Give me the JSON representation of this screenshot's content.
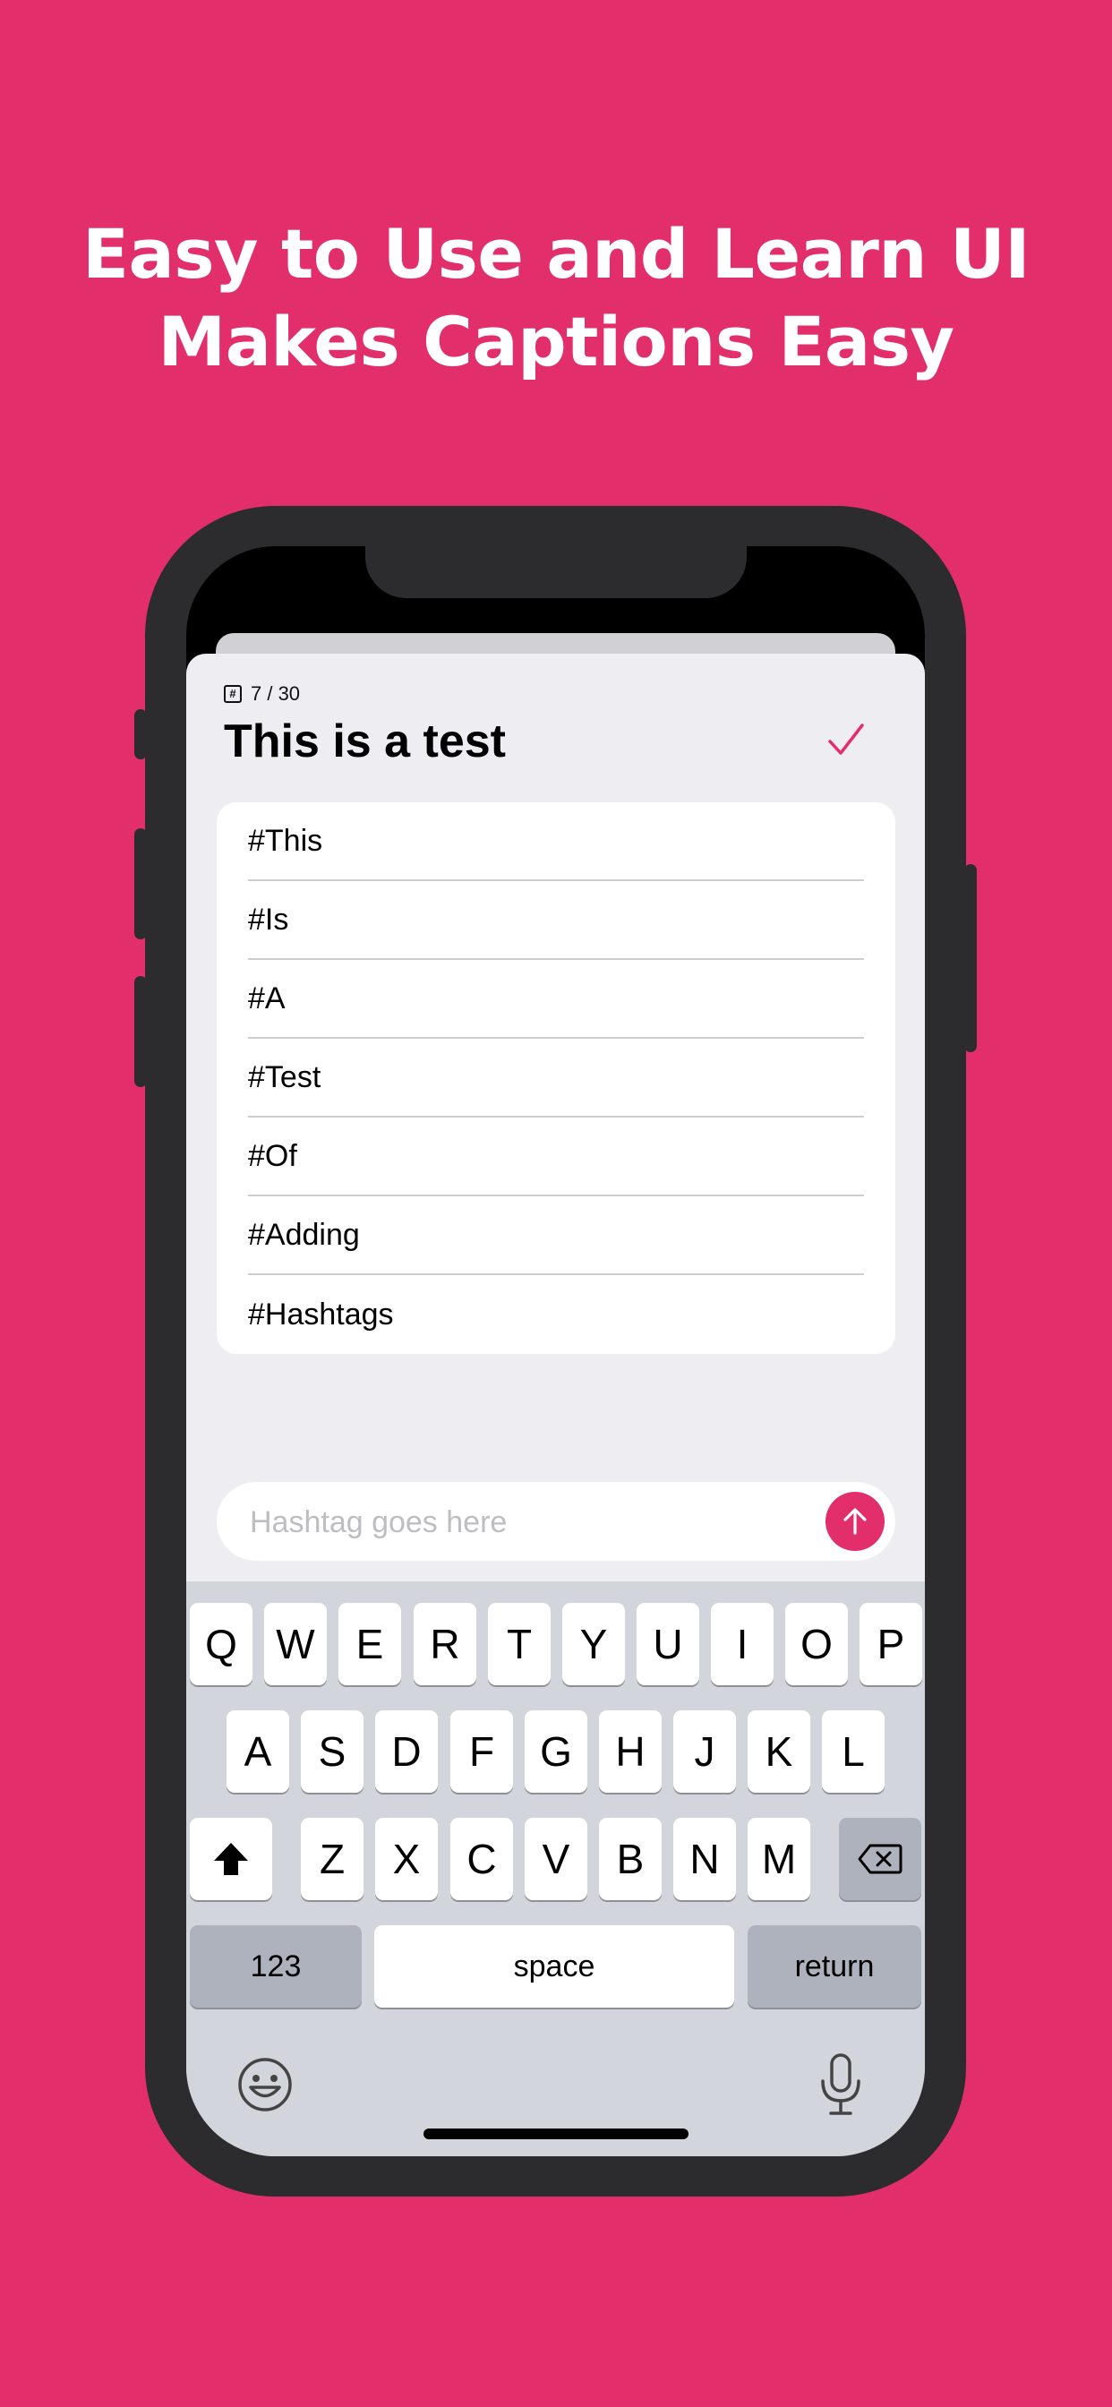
{
  "headline": {
    "line1": "Easy to Use and Learn UI",
    "line2": "Makes Captions Easy"
  },
  "colors": {
    "background": "#E22F6B",
    "accent": "#E22F6B",
    "phone_frame": "#2C2C2E"
  },
  "app": {
    "counter": "7 / 30",
    "counter_icon": "hashtag-box-icon",
    "title": "This is a test",
    "done_icon": "checkmark-icon",
    "hashtags": [
      "#This",
      "#Is",
      "#A",
      "#Test",
      "#Of",
      "#Adding",
      "#Hashtags"
    ],
    "input": {
      "value": "",
      "placeholder": "Hashtag goes here"
    },
    "send_icon": "arrow-up-icon"
  },
  "keyboard": {
    "row1": [
      "Q",
      "W",
      "E",
      "R",
      "T",
      "Y",
      "U",
      "I",
      "O",
      "P"
    ],
    "row2": [
      "A",
      "S",
      "D",
      "F",
      "G",
      "H",
      "J",
      "K",
      "L"
    ],
    "row3": [
      "Z",
      "X",
      "C",
      "V",
      "B",
      "N",
      "M"
    ],
    "numbers_label": "123",
    "space_label": "space",
    "return_label": "return",
    "shift_icon": "shift-icon",
    "delete_icon": "backspace-icon",
    "emoji_icon": "emoji-icon",
    "mic_icon": "microphone-icon"
  }
}
